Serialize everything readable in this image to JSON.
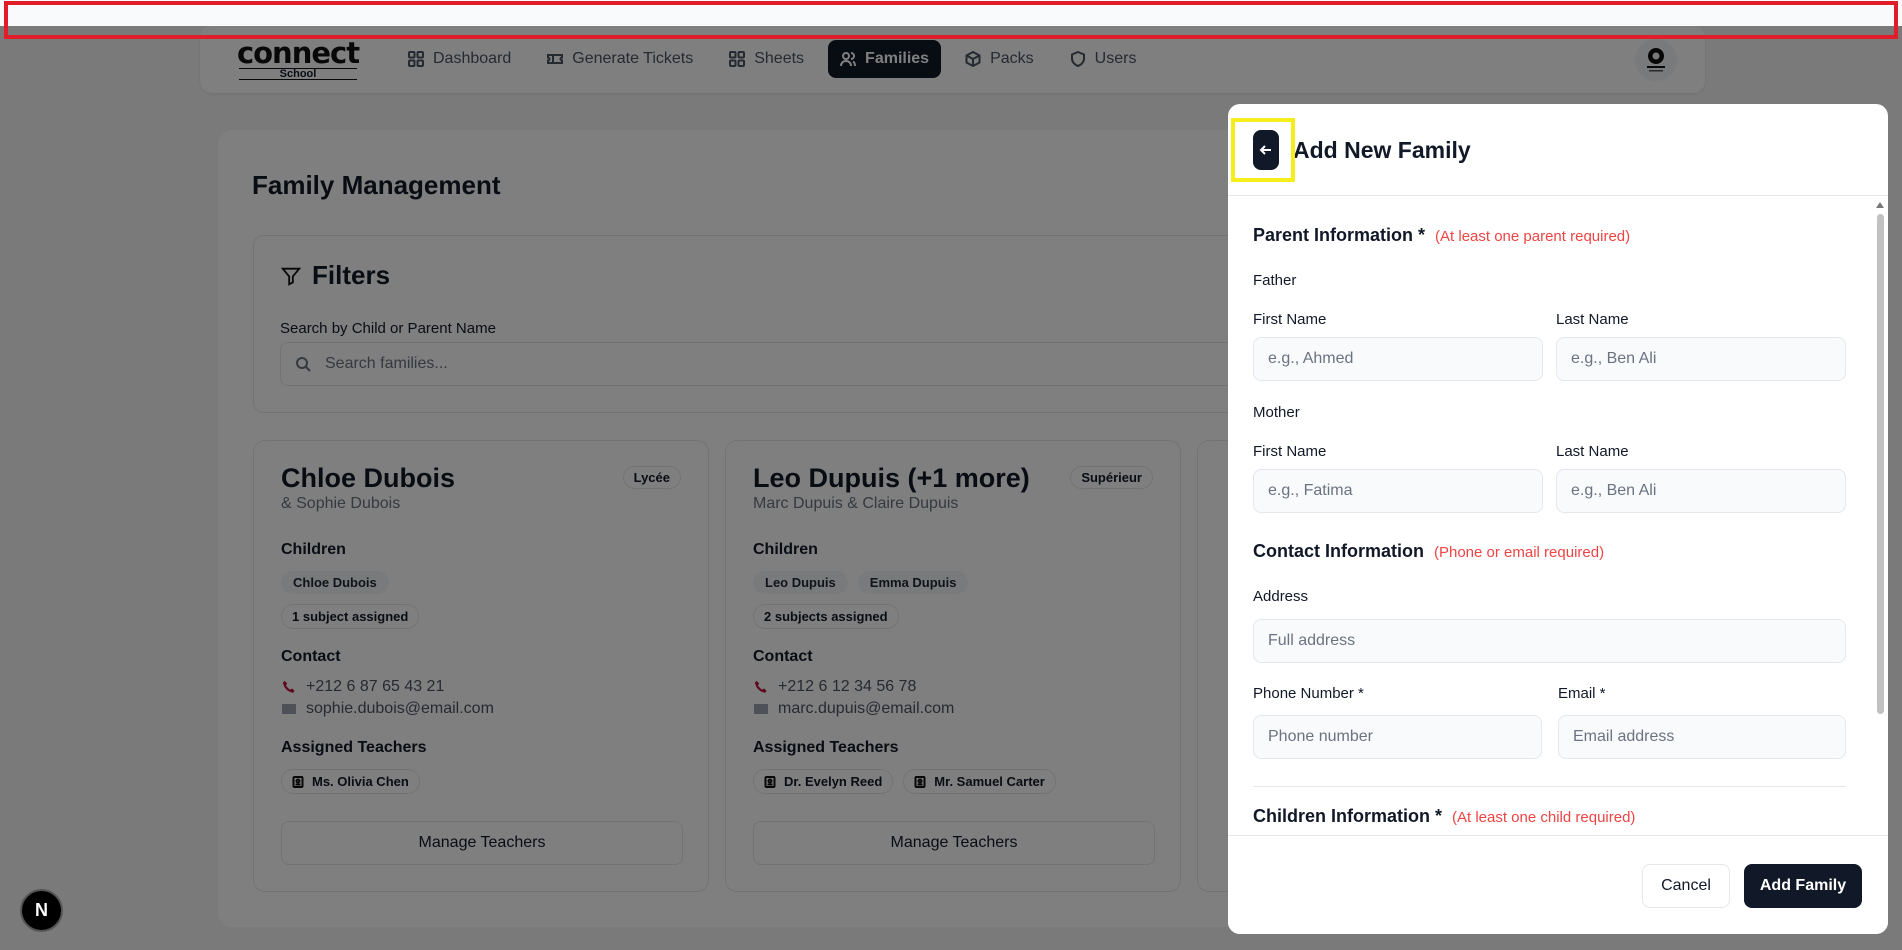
{
  "navbar": {
    "logo_main": "connect",
    "logo_sub": "School",
    "items": [
      {
        "label": "Dashboard",
        "icon": "dashboard-grid-icon"
      },
      {
        "label": "Generate Tickets",
        "icon": "ticket-icon"
      },
      {
        "label": "Sheets",
        "icon": "sheets-grid-icon"
      },
      {
        "label": "Families",
        "icon": "users-icon",
        "active": true
      },
      {
        "label": "Packs",
        "icon": "package-icon"
      },
      {
        "label": "Users",
        "icon": "shield-icon"
      }
    ],
    "avatar_icon": "profile-logo-icon"
  },
  "page": {
    "title": "Family Management",
    "filters_title": "Filters",
    "search_label": "Search by Child or Parent Name",
    "search_placeholder": "Search families..."
  },
  "families": [
    {
      "name": "Chloe Dubois",
      "parents": "& Sophie Dubois",
      "level": "Lycée",
      "children_title": "Children",
      "children": [
        "Chloe Dubois"
      ],
      "subjects": "1 subject assigned",
      "contact_title": "Contact",
      "phone": "+212 6 87 65 43 21",
      "email": "sophie.dubois@email.com",
      "teachers_title": "Assigned Teachers",
      "teachers": [
        "Ms. Olivia Chen"
      ],
      "manage_label": "Manage Teachers"
    },
    {
      "name": "Leo Dupuis (+1 more)",
      "parents": "Marc Dupuis & Claire Dupuis",
      "level": "Supérieur",
      "children_title": "Children",
      "children": [
        "Leo Dupuis",
        "Emma Dupuis"
      ],
      "subjects": "2 subjects assigned",
      "contact_title": "Contact",
      "phone": "+212 6 12 34 56 78",
      "email": "marc.dupuis@email.com",
      "teachers_title": "Assigned Teachers",
      "teachers": [
        "Dr. Evelyn Reed",
        "Mr. Samuel Carter"
      ],
      "manage_label": "Manage Teachers"
    }
  ],
  "drawer": {
    "title": "Add New Family",
    "back_icon": "arrow-left-icon",
    "parent_section": {
      "title": "Parent Information *",
      "note": "(At least one parent required)"
    },
    "father": {
      "label": "Father",
      "first_label": "First Name",
      "first_placeholder": "e.g., Ahmed",
      "last_label": "Last Name",
      "last_placeholder": "e.g., Ben Ali"
    },
    "mother": {
      "label": "Mother",
      "first_label": "First Name",
      "first_placeholder": "e.g., Fatima",
      "last_label": "Last Name",
      "last_placeholder": "e.g., Ben Ali"
    },
    "contact_section": {
      "title": "Contact Information",
      "note": "(Phone or email required)"
    },
    "address": {
      "label": "Address",
      "placeholder": "Full address"
    },
    "phone": {
      "label": "Phone Number *",
      "placeholder": "Phone number"
    },
    "email": {
      "label": "Email *",
      "placeholder": "Email address"
    },
    "children_section": {
      "title": "Children Information *",
      "note": "(At least one child required)"
    },
    "cancel_label": "Cancel",
    "submit_label": "Add Family"
  },
  "next_badge": "N",
  "colors": {
    "primary": "#111827",
    "required_note": "#ef4444",
    "annotation_red": "#e11d2a",
    "annotation_yellow": "#f5ee1c"
  }
}
